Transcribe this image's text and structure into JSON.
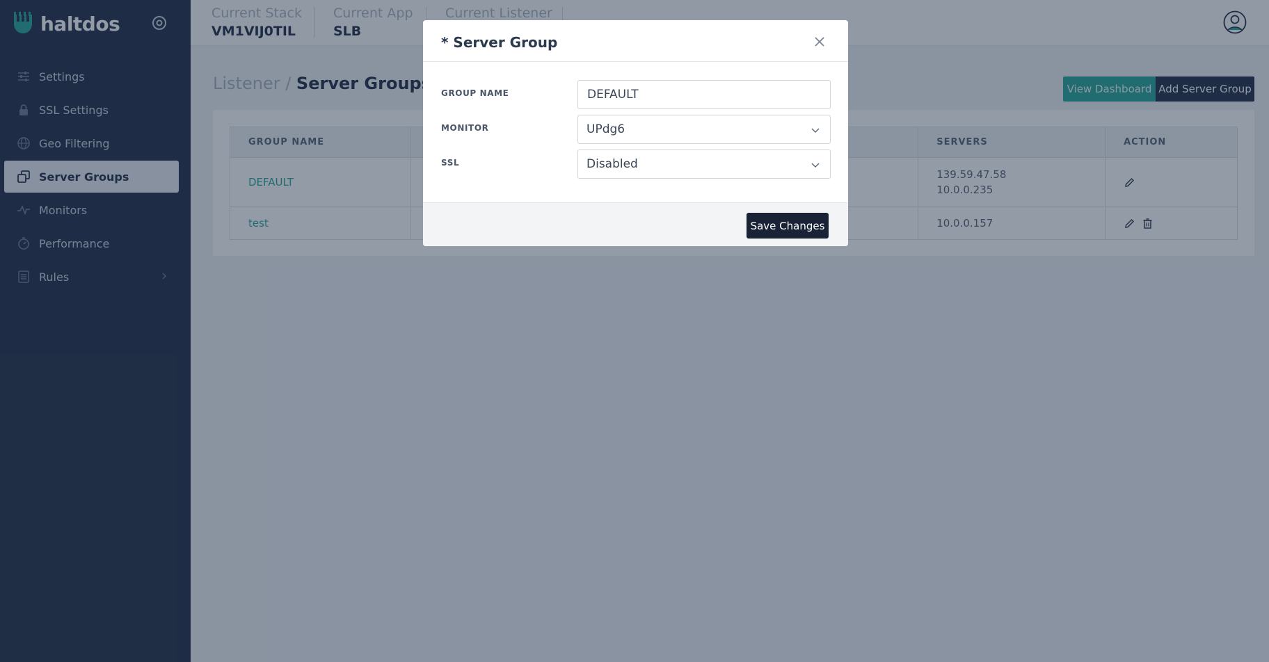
{
  "brand": {
    "name": "haltdos"
  },
  "sidebar": {
    "items": [
      {
        "label": "Settings",
        "icon": "sliders-icon"
      },
      {
        "label": "SSL Settings",
        "icon": "lock-icon"
      },
      {
        "label": "Geo Filtering",
        "icon": "globe-icon"
      },
      {
        "label": "Server Groups",
        "icon": "server-groups-icon",
        "active": true
      },
      {
        "label": "Monitors",
        "icon": "pulse-icon"
      },
      {
        "label": "Performance",
        "icon": "stopwatch-icon"
      },
      {
        "label": "Rules",
        "icon": "list-icon",
        "has_submenu": true
      }
    ]
  },
  "topbar": {
    "stack_label": "Current Stack",
    "stack_value": "VM1VIJ0TIL",
    "app_label": "Current App",
    "app_value": "SLB",
    "listener_label": "Current Listener",
    "listener_value": ""
  },
  "page": {
    "crumb_parent": "Listener /",
    "crumb_current": "Server Groups",
    "view_dashboard": "View Dashboard",
    "add_server_group": "Add Server Group"
  },
  "table": {
    "headers": {
      "group_name": "GROUP NAME",
      "servers": "SERVERS",
      "action": "ACTION"
    },
    "rows": [
      {
        "group_name": "DEFAULT",
        "servers": [
          "139.59.47.58",
          "10.0.0.235"
        ]
      },
      {
        "group_name": "test",
        "servers": [
          "10.0.0.157"
        ]
      }
    ]
  },
  "modal": {
    "title": "* Server Group",
    "fields": {
      "group_name_label": "GROUP NAME",
      "group_name_value": "DEFAULT",
      "monitor_label": "MONITOR",
      "monitor_value": "UPdg6",
      "ssl_label": "SSL",
      "ssl_value": "Disabled"
    },
    "save_label": "Save Changes"
  },
  "colors": {
    "sidebar": "#1f2d45",
    "accent": "#26a69a",
    "dark_button": "#1a2236"
  }
}
